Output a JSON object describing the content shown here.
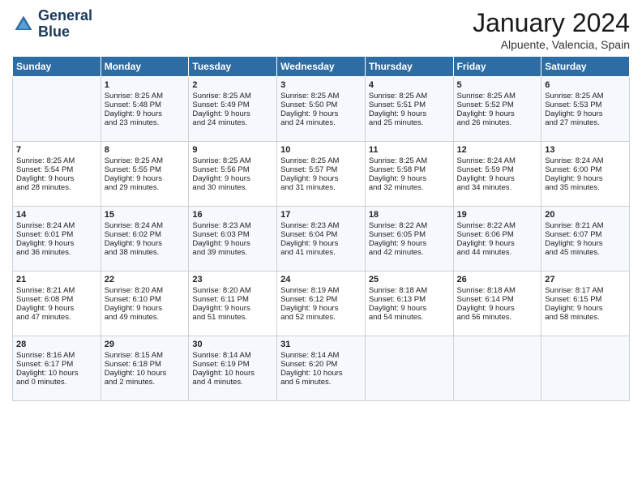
{
  "header": {
    "logo_line1": "General",
    "logo_line2": "Blue",
    "month": "January 2024",
    "location": "Alpuente, Valencia, Spain"
  },
  "days_of_week": [
    "Sunday",
    "Monday",
    "Tuesday",
    "Wednesday",
    "Thursday",
    "Friday",
    "Saturday"
  ],
  "weeks": [
    [
      {
        "day": "",
        "content": ""
      },
      {
        "day": "1",
        "content": "Sunrise: 8:25 AM\nSunset: 5:48 PM\nDaylight: 9 hours\nand 23 minutes."
      },
      {
        "day": "2",
        "content": "Sunrise: 8:25 AM\nSunset: 5:49 PM\nDaylight: 9 hours\nand 24 minutes."
      },
      {
        "day": "3",
        "content": "Sunrise: 8:25 AM\nSunset: 5:50 PM\nDaylight: 9 hours\nand 24 minutes."
      },
      {
        "day": "4",
        "content": "Sunrise: 8:25 AM\nSunset: 5:51 PM\nDaylight: 9 hours\nand 25 minutes."
      },
      {
        "day": "5",
        "content": "Sunrise: 8:25 AM\nSunset: 5:52 PM\nDaylight: 9 hours\nand 26 minutes."
      },
      {
        "day": "6",
        "content": "Sunrise: 8:25 AM\nSunset: 5:53 PM\nDaylight: 9 hours\nand 27 minutes."
      }
    ],
    [
      {
        "day": "7",
        "content": "Sunrise: 8:25 AM\nSunset: 5:54 PM\nDaylight: 9 hours\nand 28 minutes."
      },
      {
        "day": "8",
        "content": "Sunrise: 8:25 AM\nSunset: 5:55 PM\nDaylight: 9 hours\nand 29 minutes."
      },
      {
        "day": "9",
        "content": "Sunrise: 8:25 AM\nSunset: 5:56 PM\nDaylight: 9 hours\nand 30 minutes."
      },
      {
        "day": "10",
        "content": "Sunrise: 8:25 AM\nSunset: 5:57 PM\nDaylight: 9 hours\nand 31 minutes."
      },
      {
        "day": "11",
        "content": "Sunrise: 8:25 AM\nSunset: 5:58 PM\nDaylight: 9 hours\nand 32 minutes."
      },
      {
        "day": "12",
        "content": "Sunrise: 8:24 AM\nSunset: 5:59 PM\nDaylight: 9 hours\nand 34 minutes."
      },
      {
        "day": "13",
        "content": "Sunrise: 8:24 AM\nSunset: 6:00 PM\nDaylight: 9 hours\nand 35 minutes."
      }
    ],
    [
      {
        "day": "14",
        "content": "Sunrise: 8:24 AM\nSunset: 6:01 PM\nDaylight: 9 hours\nand 36 minutes."
      },
      {
        "day": "15",
        "content": "Sunrise: 8:24 AM\nSunset: 6:02 PM\nDaylight: 9 hours\nand 38 minutes."
      },
      {
        "day": "16",
        "content": "Sunrise: 8:23 AM\nSunset: 6:03 PM\nDaylight: 9 hours\nand 39 minutes."
      },
      {
        "day": "17",
        "content": "Sunrise: 8:23 AM\nSunset: 6:04 PM\nDaylight: 9 hours\nand 41 minutes."
      },
      {
        "day": "18",
        "content": "Sunrise: 8:22 AM\nSunset: 6:05 PM\nDaylight: 9 hours\nand 42 minutes."
      },
      {
        "day": "19",
        "content": "Sunrise: 8:22 AM\nSunset: 6:06 PM\nDaylight: 9 hours\nand 44 minutes."
      },
      {
        "day": "20",
        "content": "Sunrise: 8:21 AM\nSunset: 6:07 PM\nDaylight: 9 hours\nand 45 minutes."
      }
    ],
    [
      {
        "day": "21",
        "content": "Sunrise: 8:21 AM\nSunset: 6:08 PM\nDaylight: 9 hours\nand 47 minutes."
      },
      {
        "day": "22",
        "content": "Sunrise: 8:20 AM\nSunset: 6:10 PM\nDaylight: 9 hours\nand 49 minutes."
      },
      {
        "day": "23",
        "content": "Sunrise: 8:20 AM\nSunset: 6:11 PM\nDaylight: 9 hours\nand 51 minutes."
      },
      {
        "day": "24",
        "content": "Sunrise: 8:19 AM\nSunset: 6:12 PM\nDaylight: 9 hours\nand 52 minutes."
      },
      {
        "day": "25",
        "content": "Sunrise: 8:18 AM\nSunset: 6:13 PM\nDaylight: 9 hours\nand 54 minutes."
      },
      {
        "day": "26",
        "content": "Sunrise: 8:18 AM\nSunset: 6:14 PM\nDaylight: 9 hours\nand 56 minutes."
      },
      {
        "day": "27",
        "content": "Sunrise: 8:17 AM\nSunset: 6:15 PM\nDaylight: 9 hours\nand 58 minutes."
      }
    ],
    [
      {
        "day": "28",
        "content": "Sunrise: 8:16 AM\nSunset: 6:17 PM\nDaylight: 10 hours\nand 0 minutes."
      },
      {
        "day": "29",
        "content": "Sunrise: 8:15 AM\nSunset: 6:18 PM\nDaylight: 10 hours\nand 2 minutes."
      },
      {
        "day": "30",
        "content": "Sunrise: 8:14 AM\nSunset: 6:19 PM\nDaylight: 10 hours\nand 4 minutes."
      },
      {
        "day": "31",
        "content": "Sunrise: 8:14 AM\nSunset: 6:20 PM\nDaylight: 10 hours\nand 6 minutes."
      },
      {
        "day": "",
        "content": ""
      },
      {
        "day": "",
        "content": ""
      },
      {
        "day": "",
        "content": ""
      }
    ]
  ]
}
